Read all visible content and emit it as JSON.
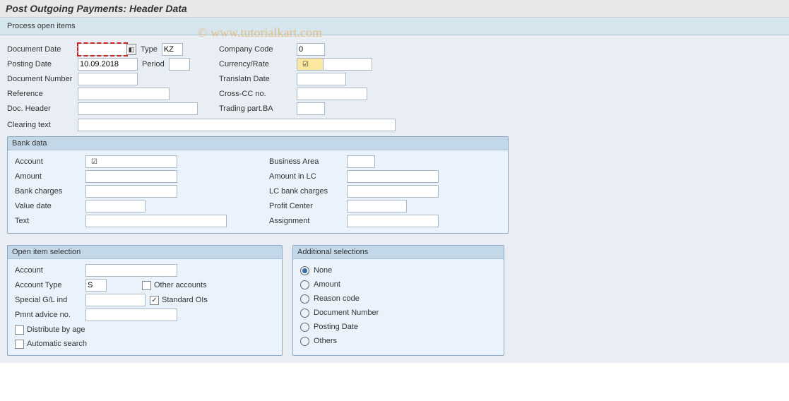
{
  "title": "Post Outgoing Payments: Header Data",
  "toolbar": {
    "process": "Process open items"
  },
  "watermark": "© www.tutorialkart.com",
  "header": {
    "left": {
      "doc_date_lbl": "Document Date",
      "doc_date_val": "",
      "type_lbl": "Type",
      "type_val": "KZ",
      "posting_date_lbl": "Posting Date",
      "posting_date_val": "10.09.2018",
      "period_lbl": "Period",
      "period_val": "",
      "doc_num_lbl": "Document Number",
      "doc_num_val": "",
      "reference_lbl": "Reference",
      "reference_val": "",
      "doc_header_lbl": "Doc. Header",
      "doc_header_val": "",
      "clearing_lbl": "Clearing text",
      "clearing_val": ""
    },
    "right": {
      "company_lbl": "Company Code",
      "company_val": "0",
      "currency_lbl": "Currency/Rate",
      "currency_val": "",
      "rate_val": "",
      "trans_date_lbl": "Translatn Date",
      "trans_date_val": "",
      "cross_cc_lbl": "Cross-CC no.",
      "cross_cc_val": "",
      "trading_lbl": "Trading part.BA",
      "trading_val": ""
    }
  },
  "bank": {
    "title": "Bank data",
    "left": {
      "account_lbl": "Account",
      "account_val": "",
      "amount_lbl": "Amount",
      "amount_val": "",
      "charges_lbl": "Bank charges",
      "charges_val": "",
      "value_date_lbl": "Value date",
      "value_date_val": "",
      "text_lbl": "Text",
      "text_val": ""
    },
    "right": {
      "bus_area_lbl": "Business Area",
      "bus_area_val": "",
      "amount_lc_lbl": "Amount in LC",
      "amount_lc_val": "",
      "lc_charges_lbl": "LC bank charges",
      "lc_charges_val": "",
      "profit_lbl": "Profit Center",
      "profit_val": "",
      "assign_lbl": "Assignment",
      "assign_val": ""
    }
  },
  "open_items": {
    "title": "Open item selection",
    "account_lbl": "Account",
    "account_val": "",
    "acc_type_lbl": "Account Type",
    "acc_type_val": "S",
    "other_acc_lbl": "Other accounts",
    "special_lbl": "Special G/L ind",
    "special_val": "",
    "standard_lbl": "Standard OIs",
    "advice_lbl": "Pmnt advice no.",
    "advice_val": "",
    "distribute_lbl": "Distribute by age",
    "auto_search_lbl": "Automatic search"
  },
  "additional": {
    "title": "Additional selections",
    "options": [
      "None",
      "Amount",
      "Reason code",
      "Document Number",
      "Posting Date",
      "Others"
    ],
    "selected": 0
  }
}
